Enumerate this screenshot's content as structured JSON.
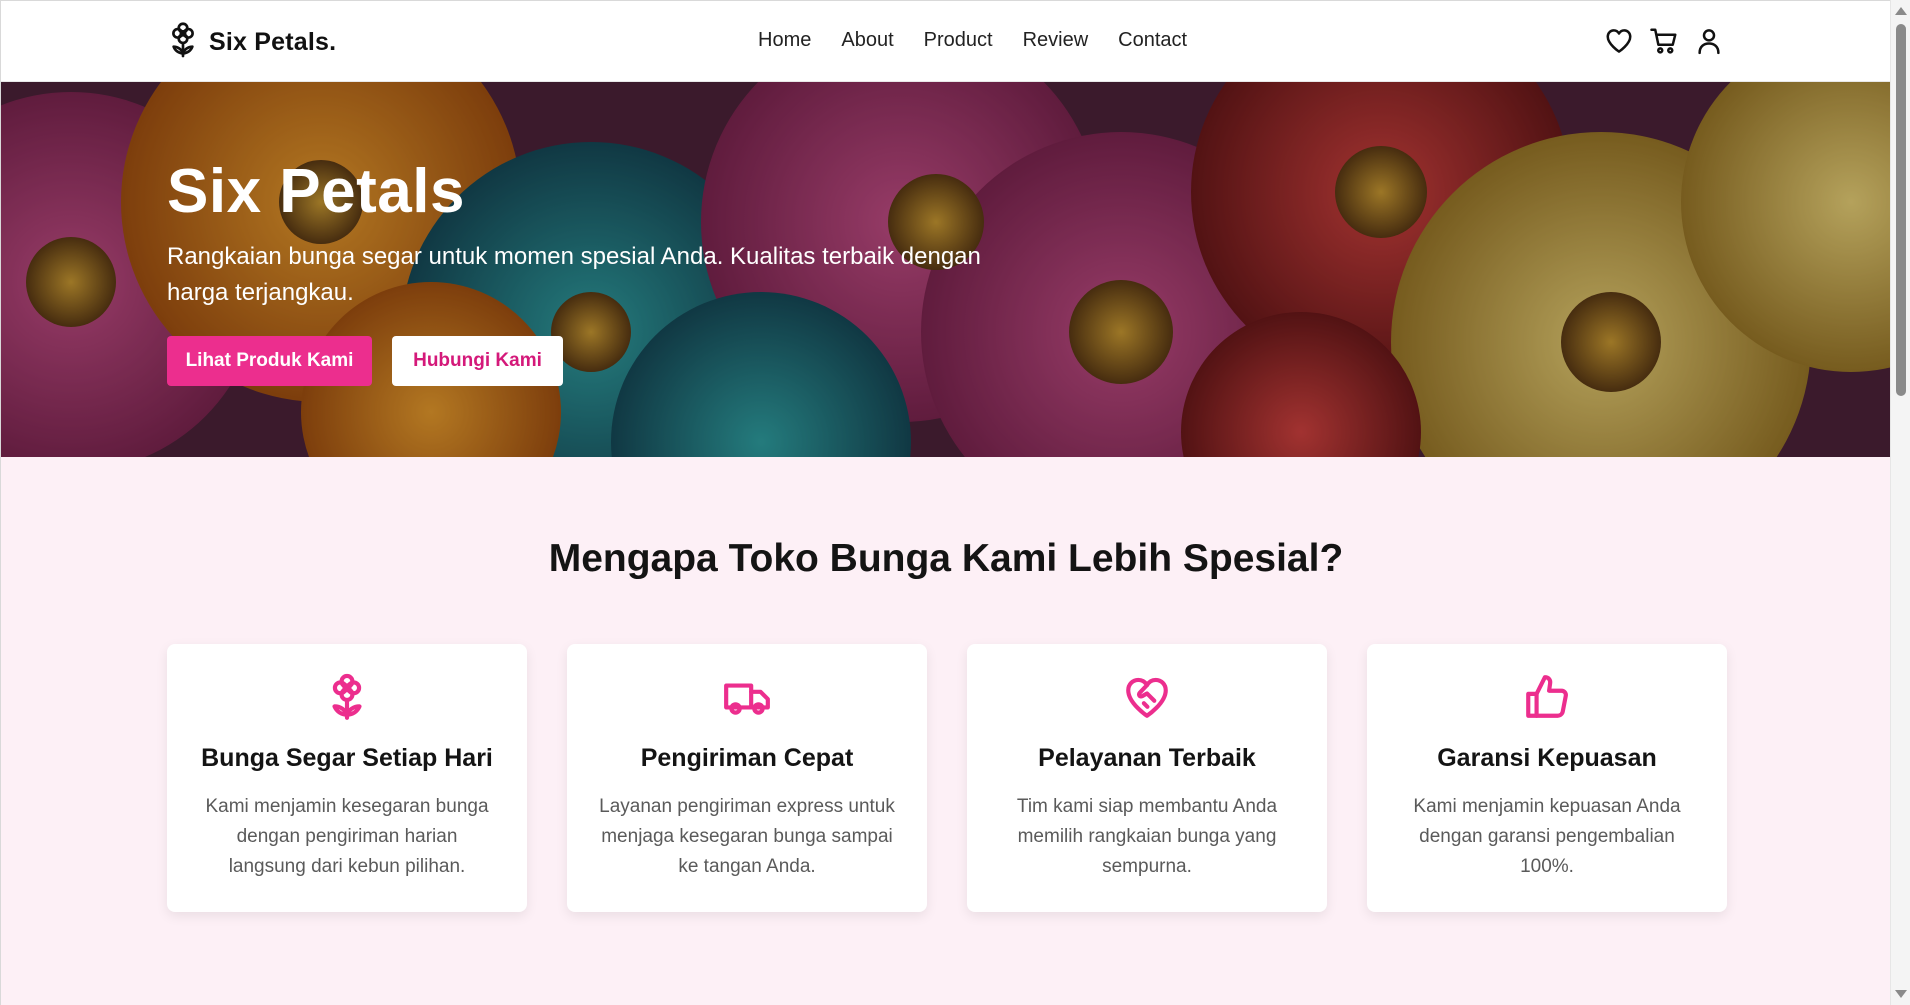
{
  "brand": {
    "name": "Six Petals.",
    "icon": "flower-icon"
  },
  "nav": [
    "Home",
    "About",
    "Product",
    "Review",
    "Contact"
  ],
  "header_icons": [
    "heart-icon",
    "cart-icon",
    "user-icon"
  ],
  "hero": {
    "title": "Six Petals",
    "subtitle": "Rangkaian bunga segar untuk momen spesial Anda. Kualitas terbaik dengan harga terjangkau.",
    "primary_button": "Lihat Produk Kami",
    "secondary_button": "Hubungi Kami"
  },
  "features": {
    "title": "Mengapa Toko Bunga Kami Lebih Spesial?",
    "cards": [
      {
        "icon": "flower-icon",
        "title": "Bunga Segar Setiap Hari",
        "text": "Kami menjamin kesegaran bunga dengan pengiriman harian langsung dari kebun pilihan."
      },
      {
        "icon": "truck-icon",
        "title": "Pengiriman Cepat",
        "text": "Layanan pengiriman express untuk menjaga kesegaran bunga sampai ke tangan Anda."
      },
      {
        "icon": "heart-handshake-icon",
        "title": "Pelayanan Terbaik",
        "text": "Tim kami siap membantu Anda memilih rangkaian bunga yang sempurna."
      },
      {
        "icon": "thumbs-up-icon",
        "title": "Garansi Kepuasan",
        "text": "Kami menjamin kepuasan Anda dengan garansi pengembalian 100%."
      }
    ]
  },
  "colors": {
    "accent": "#ec2e8e",
    "section_bg": "#fdf0f6",
    "header_bg": "#ffffff",
    "card_bg": "#ffffff"
  }
}
